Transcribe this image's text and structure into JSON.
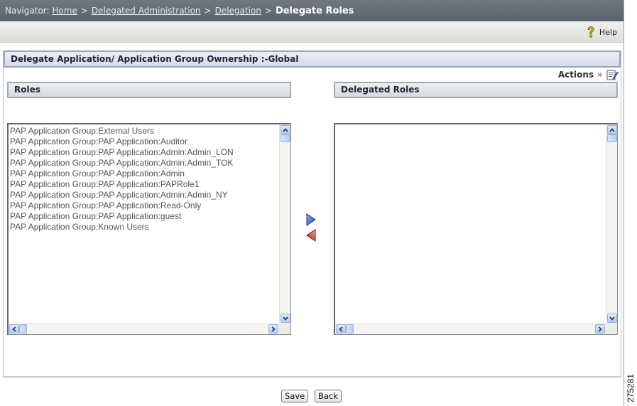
{
  "navigator": {
    "prefix": "Navigator:",
    "crumbs": [
      "Home",
      "Delegated Administration",
      "Delegation"
    ],
    "separator": ">",
    "current": "Delegate Roles"
  },
  "toolbar": {
    "help_label": "Help"
  },
  "panel": {
    "title": "Delegate Application/ Application Group Ownership :-Global",
    "actions_label": "Actions",
    "actions_chevron": "»"
  },
  "roles": {
    "header": "Roles",
    "items": [
      "PAP Application Group:External Users",
      "PAP Application Group:PAP Application:Auditor",
      "PAP Application Group:PAP Application:Admin:Admin_LON",
      "PAP Application Group:PAP Application:Admin:Admin_TOK",
      "PAP Application Group:PAP Application:Admin",
      "PAP Application Group:PAP Application:PAPRole1",
      "PAP Application Group:PAP Application:Admin:Admin_NY",
      "PAP Application Group:PAP Application:Read-Only",
      "PAP Application Group:PAP Application:guest",
      "PAP Application Group:Known Users"
    ]
  },
  "delegated_roles": {
    "header": "Delegated Roles",
    "items": []
  },
  "buttons": {
    "save": "Save",
    "back": "Back"
  },
  "figure_id": "275281",
  "colors": {
    "nav_bg": "#5f6870",
    "add_arrow": "#3b63c7",
    "remove_arrow": "#c0463c"
  }
}
